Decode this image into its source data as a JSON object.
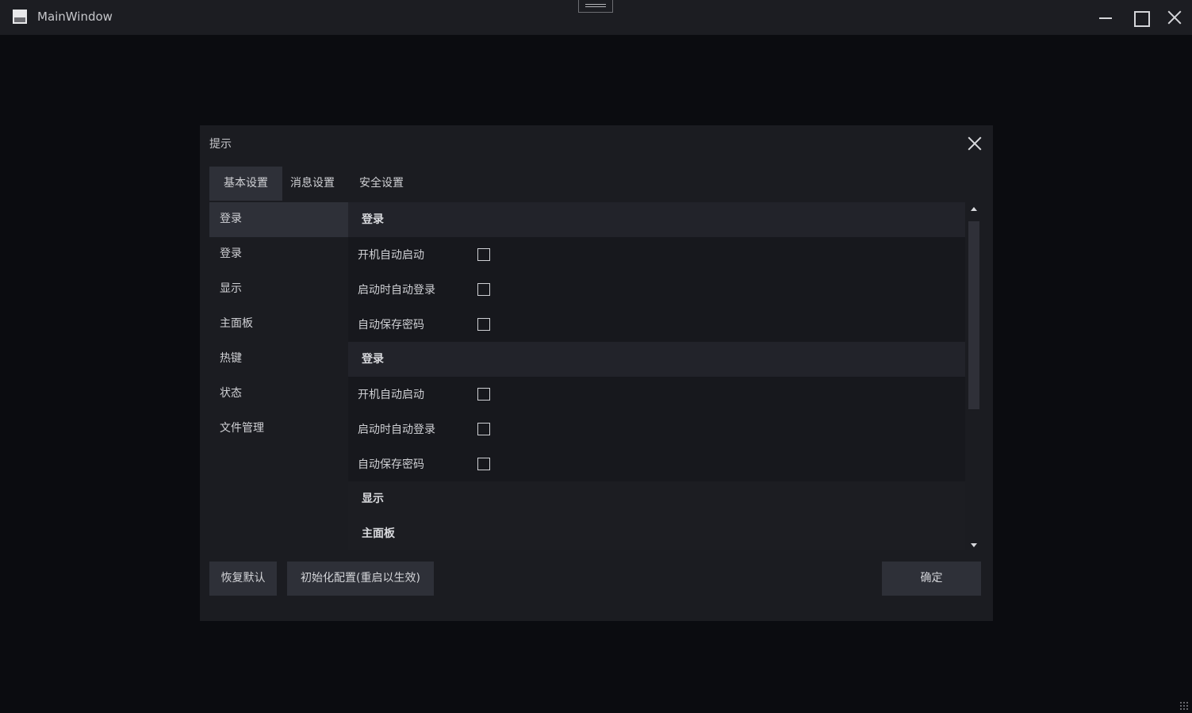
{
  "window": {
    "title": "MainWindow"
  },
  "dialog": {
    "title": "提示",
    "tabs": [
      {
        "label": "基本设置",
        "active": true
      },
      {
        "label": "消息设置",
        "active": false
      },
      {
        "label": "安全设置",
        "active": false
      }
    ],
    "nav": [
      {
        "label": "登录",
        "active": true
      },
      {
        "label": "登录",
        "active": false
      },
      {
        "label": "显示",
        "active": false
      },
      {
        "label": "主面板",
        "active": false
      },
      {
        "label": "热键",
        "active": false
      },
      {
        "label": "状态",
        "active": false
      },
      {
        "label": "文件管理",
        "active": false
      }
    ],
    "sections": [
      {
        "title": "登录",
        "options": [
          {
            "label": "开机自动启动",
            "checked": false
          },
          {
            "label": "启动时自动登录",
            "checked": false
          },
          {
            "label": "自动保存密码",
            "checked": false
          }
        ]
      },
      {
        "title": "登录",
        "options": [
          {
            "label": "开机自动启动",
            "checked": false
          },
          {
            "label": "启动时自动登录",
            "checked": false
          },
          {
            "label": "自动保存密码",
            "checked": false
          }
        ]
      },
      {
        "title": "显示",
        "options": []
      },
      {
        "title": "主面板",
        "options": []
      }
    ],
    "buttons": {
      "reset": "恢复默认",
      "init": "初始化配置(重启以生效)",
      "ok": "确定"
    }
  }
}
